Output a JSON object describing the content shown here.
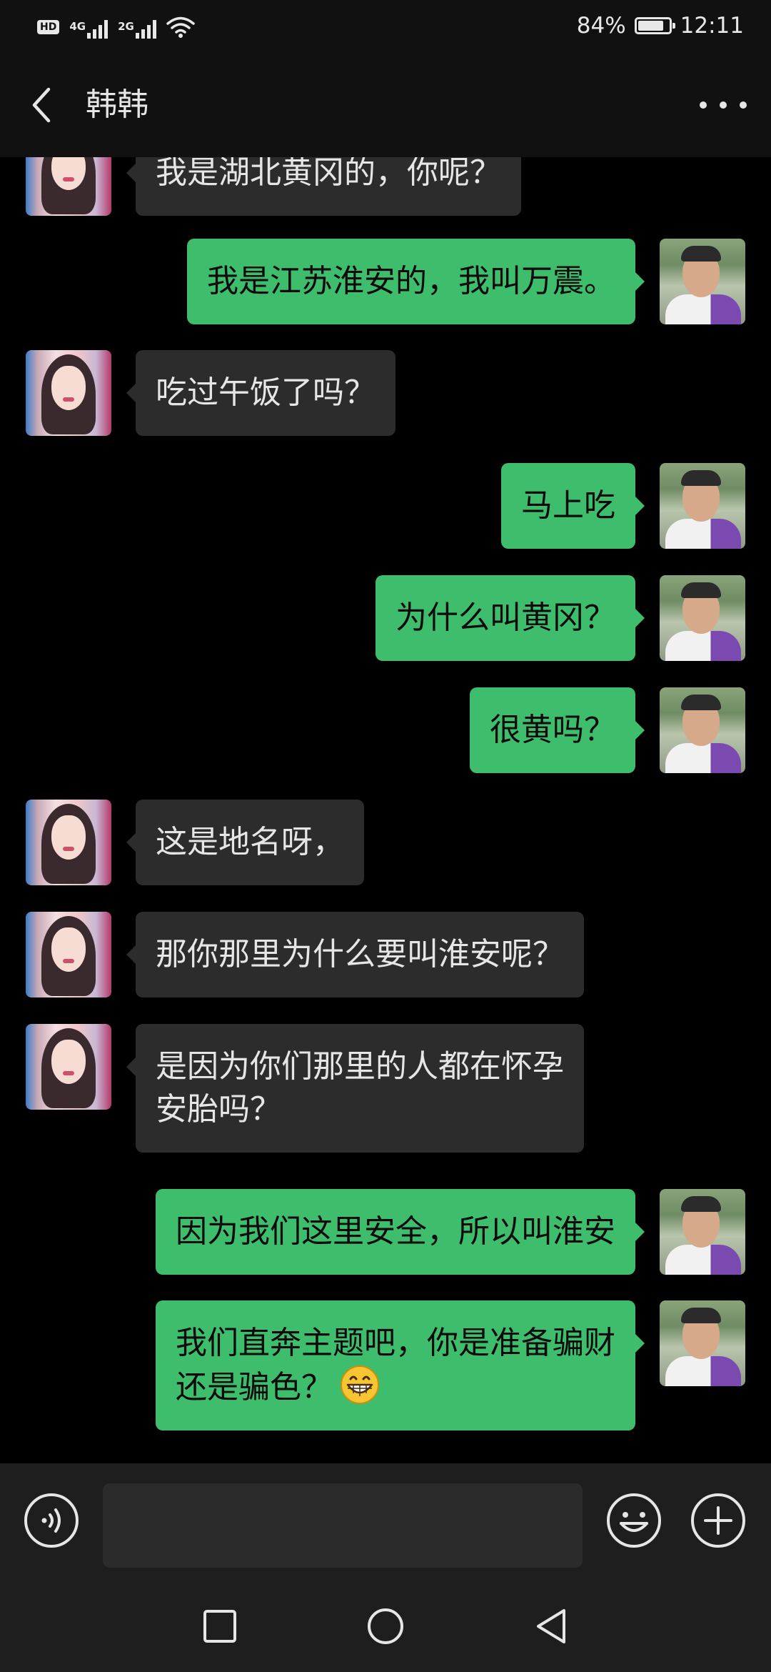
{
  "status_bar": {
    "hd_label": "HD",
    "network_1": "4G",
    "network_2": "2G",
    "battery_percent": "84%",
    "battery_level": 0.84,
    "time": "12:11"
  },
  "header": {
    "title": "韩韩"
  },
  "messages": [
    {
      "side": "left",
      "text": "我是湖北黄冈的，你呢？"
    },
    {
      "side": "right",
      "text": "我是江苏淮安的，我叫万震。"
    },
    {
      "side": "left",
      "text": "吃过午饭了吗？"
    },
    {
      "side": "right",
      "text": "马上吃"
    },
    {
      "side": "right",
      "text": "为什么叫黄冈？"
    },
    {
      "side": "right",
      "text": "很黄吗？"
    },
    {
      "side": "left",
      "text": "这是地名呀，"
    },
    {
      "side": "left",
      "text": "那你那里为什么要叫淮安呢？"
    },
    {
      "side": "left",
      "text": "是因为你们那里的人都在怀孕\n安胎吗？"
    },
    {
      "side": "right",
      "text": "因为我们这里安全，所以叫淮安"
    },
    {
      "side": "right",
      "text": "我们直奔主题吧，你是准备骗财\n还是骗色？",
      "emoji": "grinning-emoji"
    }
  ],
  "input_bar": {
    "value": "",
    "placeholder": ""
  },
  "icons": {
    "back": "back-arrow-icon",
    "more": "more-dots-icon",
    "voice": "voice-icon",
    "emoji": "emoji-icon",
    "plus": "plus-icon",
    "nav_recent": "square-icon",
    "nav_home": "circle-icon",
    "nav_back": "triangle-back-icon"
  },
  "colors": {
    "sent_bubble": "#3ebd6c",
    "received_bubble": "#2c2c2c",
    "background": "#000000",
    "header_bg": "#111111"
  }
}
